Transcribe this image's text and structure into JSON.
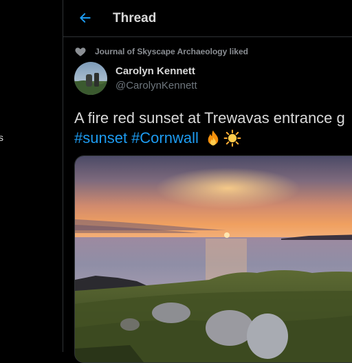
{
  "left_rail": {
    "fragment": "s"
  },
  "header": {
    "title": "Thread"
  },
  "social_context": {
    "text": "Journal of Skyscape Archaeology liked"
  },
  "author": {
    "name": "Carolyn Kennett",
    "handle": "@CarolynKennett"
  },
  "tweet": {
    "text": "A fire red sunset at Trewavas entrance g",
    "hashtags": [
      "#sunset",
      "#Cornwall"
    ],
    "emojis": [
      "fire-icon",
      "sun-icon"
    ]
  },
  "colors": {
    "accent": "#1d9bf0",
    "background": "#000000",
    "divider": "#2f3336"
  }
}
